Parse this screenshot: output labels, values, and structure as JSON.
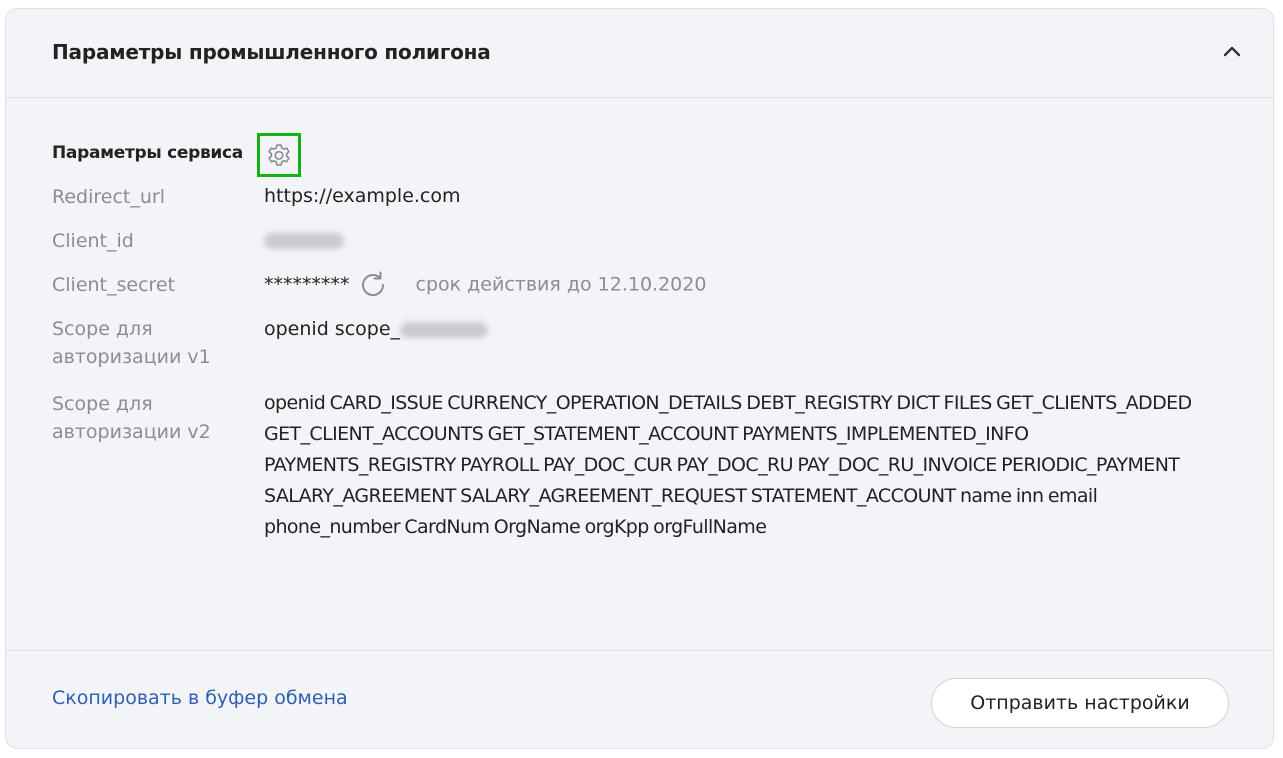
{
  "card": {
    "title": "Параметры промышленного полигона",
    "collapse_icon": "chevron-up-icon"
  },
  "service": {
    "title": "Параметры сервиса",
    "settings_icon": "gear-icon",
    "rows": {
      "redirect_url": {
        "label": "Redirect_url",
        "value": "https://example.com"
      },
      "client_id": {
        "label": "Client_id",
        "value": ""
      },
      "client_secret": {
        "label": "Client_secret",
        "value": "*********",
        "refresh_icon": "refresh-icon",
        "expiry": "срок действия до 12.10.2020"
      },
      "scope_v1": {
        "label": "Scope для авторизации v1",
        "value": "openid scope_"
      },
      "scope_v2": {
        "label": "Scope для авторизации v2",
        "value": "openid CARD_ISSUE CURRENCY_OPERATION_DETAILS DEBT_REGISTRY DICT FILES GET_CLIENTS_ADDED GET_CLIENT_ACCOUNTS GET_STATEMENT_ACCOUNT PAYMENTS_IMPLEMENTED_INFO PAYMENTS_REGISTRY PAYROLL PAY_DOC_CUR PAY_DOC_RU PAY_DOC_RU_INVOICE PERIODIC_PAYMENT SALARY_AGREEMENT SALARY_AGREEMENT_REQUEST STATEMENT_ACCOUNT name inn email phone_number CardNum OrgName orgKpp orgFullName"
      }
    }
  },
  "footer": {
    "copy_link": "Скопировать в буфер обмена",
    "send_button": "Отправить настройки"
  },
  "colors": {
    "highlight": "#12b312",
    "link": "#2f5fb3",
    "muted": "#8a8d93"
  }
}
